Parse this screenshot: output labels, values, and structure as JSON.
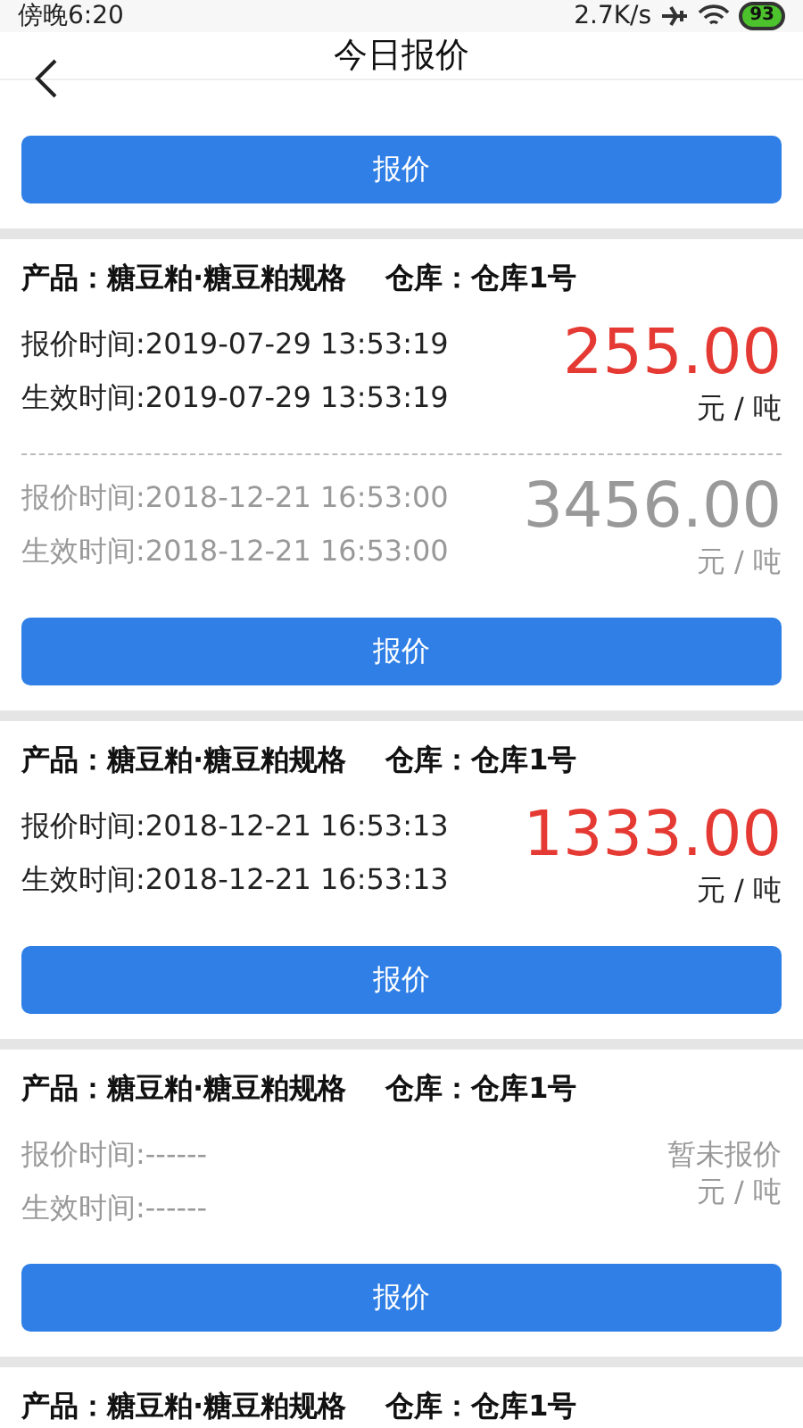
{
  "status_bar": {
    "time": "傍晚6:20",
    "speed": "2.7K/s",
    "battery": "93"
  },
  "header": {
    "title": "今日报价"
  },
  "top_fragment": {
    "button": "报价"
  },
  "cards": [
    {
      "product": "产品：糖豆粕·糖豆粕规格",
      "warehouse": "仓库：仓库1号",
      "entries": [
        {
          "kind": "price",
          "muted": false,
          "quote_time": "报价时间:2019-07-29 13:53:19",
          "effective_time": "生效时间:2019-07-29 13:53:19",
          "price": "255.00",
          "unit": "元 / 吨"
        },
        {
          "kind": "price",
          "muted": true,
          "quote_time": "报价时间:2018-12-21 16:53:00",
          "effective_time": "生效时间:2018-12-21 16:53:00",
          "price": "3456.00",
          "unit": "元 / 吨"
        }
      ],
      "button": "报价"
    },
    {
      "product": "产品：糖豆粕·糖豆粕规格",
      "warehouse": "仓库：仓库1号",
      "entries": [
        {
          "kind": "price",
          "muted": false,
          "quote_time": "报价时间:2018-12-21 16:53:13",
          "effective_time": "生效时间:2018-12-21 16:53:13",
          "price": "1333.00",
          "unit": "元 / 吨"
        }
      ],
      "button": "报价"
    },
    {
      "product": "产品：糖豆粕·糖豆粕规格",
      "warehouse": "仓库：仓库1号",
      "entries": [
        {
          "kind": "none",
          "muted": true,
          "quote_time": "报价时间:------",
          "effective_time": "生效时间:------",
          "price": "暂未报价",
          "unit": "元 / 吨"
        }
      ],
      "button": "报价"
    },
    {
      "product": "产品：糖豆粕·糖豆粕规格",
      "warehouse": "仓库：仓库1号"
    }
  ]
}
